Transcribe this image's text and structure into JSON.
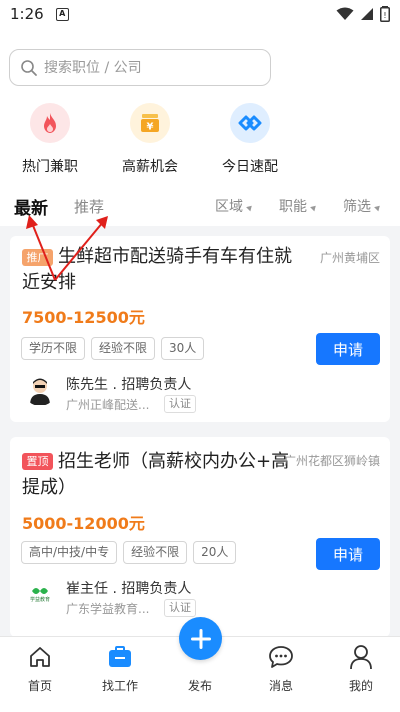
{
  "status_bar": {
    "time": "1:26",
    "notification_icon": "A"
  },
  "search": {
    "placeholder": "搜索职位 / 公司"
  },
  "quick_entries": [
    {
      "label": "热门兼职",
      "icon": "flame-icon",
      "color": "#f2545b"
    },
    {
      "label": "高薪机会",
      "icon": "money-bag-icon",
      "color": "#f5a623"
    },
    {
      "label": "今日速配",
      "icon": "match-icon",
      "color": "#1a8cff"
    }
  ],
  "filter_bar": {
    "tabs": [
      {
        "label": "最新",
        "active": true
      },
      {
        "label": "推荐",
        "active": false
      }
    ],
    "dropdowns": [
      {
        "label": "区域"
      },
      {
        "label": "职能"
      },
      {
        "label": "筛选"
      }
    ]
  },
  "jobs": [
    {
      "badge": "推广",
      "badge_color": "#f5a36b",
      "title": "生鲜超市配送骑手有车有住就近安排",
      "location": "广州黄埔区",
      "salary": "7500-12500元",
      "tags": [
        "学历不限",
        "经验不限",
        "30人"
      ],
      "apply_label": "申请",
      "recruiter": "陈先生 . 招聘负责人",
      "company": "广州正峰配送...",
      "verify_label": "认证"
    },
    {
      "badge": "置顶",
      "badge_color": "#f2545b",
      "title": "招生老师（高薪校内办公+高提成）",
      "location": "广州花都区狮岭镇",
      "salary": "5000-12000元",
      "tags": [
        "高中/中技/中专",
        "经验不限",
        "20人"
      ],
      "apply_label": "申请",
      "recruiter": "崔主任 . 招聘负责人",
      "company": "广东学益教育...",
      "verify_label": "认证",
      "avatar_logo_text": "学益教育"
    }
  ],
  "tabbar": [
    {
      "label": "首页",
      "icon": "home-icon"
    },
    {
      "label": "找工作",
      "icon": "briefcase-icon"
    },
    {
      "label": "发布",
      "icon": "plus-icon"
    },
    {
      "label": "消息",
      "icon": "message-icon"
    },
    {
      "label": "我的",
      "icon": "user-icon"
    }
  ],
  "colors": {
    "accent": "#1677ff",
    "salary": "#f07b1a",
    "annotation": "#e0201b"
  }
}
